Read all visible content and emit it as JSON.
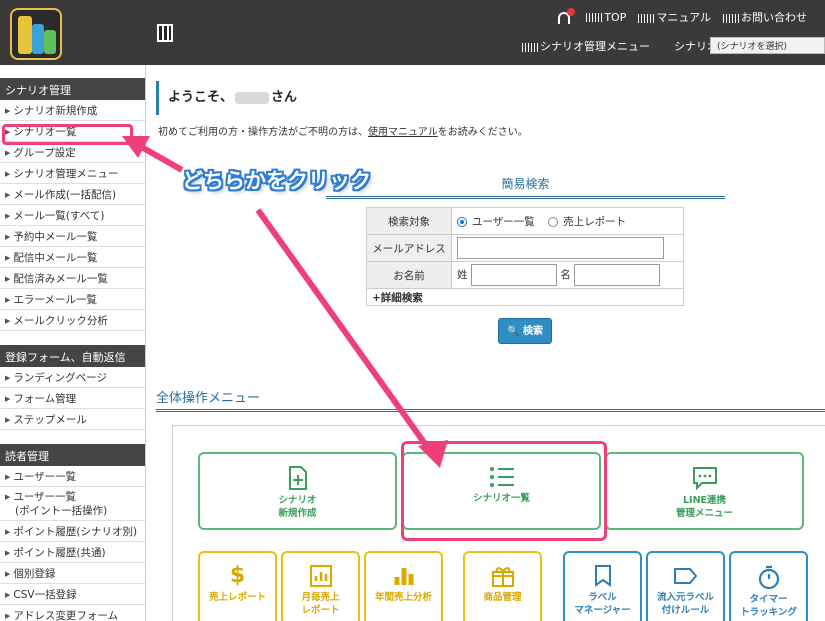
{
  "header": {
    "nav": {
      "top": "TOP",
      "manual": "マニュアル",
      "contact": "お問い合わせ"
    },
    "subnav": {
      "scenario_menu": "シナリオ管理メニュー",
      "scenario_label": "シナリオ"
    },
    "scenario_select_placeholder": "(シナリオを選択)"
  },
  "sidebar": {
    "section1": {
      "title": "シナリオ管理",
      "items": [
        "シナリオ新規作成",
        "シナリオ一覧",
        "グループ設定",
        "シナリオ管理メニュー",
        "メール作成(一括配信)",
        "メール一覧(すべて)",
        "予約中メール一覧",
        "配信中メール一覧",
        "配信済みメール一覧",
        "エラーメール一覧",
        "メールクリック分析"
      ]
    },
    "section2": {
      "title": "登録フォーム、自動返信",
      "items": [
        "ランディングページ",
        "フォーム管理",
        "ステップメール"
      ]
    },
    "section3": {
      "title": "読者管理",
      "items": [
        "ユーザー一覧",
        "ユーザー一覧",
        "(ポイント一括操作)",
        "ポイント履歴(シナリオ別)",
        "ポイント履歴(共通)",
        "個別登録",
        "CSV一括登録",
        "アドレス変更フォーム"
      ]
    }
  },
  "main": {
    "welcome_prefix": "ようこそ、",
    "welcome_suffix": "さん",
    "intro_before": "初めてご利用の方・操作方法がご不明の方は、",
    "intro_link": "使用マニュアル",
    "intro_after": "をお読みください。",
    "search": {
      "title": "簡易検索",
      "target_label": "検索対象",
      "option_users": "ユーザー一覧",
      "option_sales": "売上レポート",
      "email_label": "メールアドレス",
      "name_label": "お名前",
      "last_name": "姓",
      "first_name": "名",
      "detail": "+詳細検索",
      "button": "検索"
    },
    "menu_title": "全体操作メニュー",
    "cards_row1": [
      {
        "line1": "シナリオ",
        "line2": "新規作成",
        "icon": "file-plus-icon"
      },
      {
        "line1": "シナリオ一覧",
        "line2": "",
        "icon": "list-icon"
      },
      {
        "line1": "LINE連携",
        "line2": "管理メニュー",
        "icon": "chat-icon"
      }
    ],
    "cards_row2": [
      {
        "line1": "売上レポート",
        "line2": "",
        "icon": "dollar-icon"
      },
      {
        "line1": "月毎売上",
        "line2": "レポート",
        "icon": "bar-chart-icon"
      },
      {
        "line1": "年間売上分析",
        "line2": "",
        "icon": "bar-chart-icon"
      },
      {
        "line1": "商品管理",
        "line2": "",
        "icon": "gift-icon"
      },
      {
        "line1": "ラベル",
        "line2": "マネージャー",
        "icon": "bookmark-icon"
      },
      {
        "line1": "流入元ラベル",
        "line2": "付けルール",
        "icon": "tag-icon"
      },
      {
        "line1": "タイマー",
        "line2": "トラッキング",
        "icon": "stopwatch-icon"
      }
    ]
  },
  "annotation": {
    "callout": "どちらかをクリック",
    "color": "#ef3f79"
  }
}
